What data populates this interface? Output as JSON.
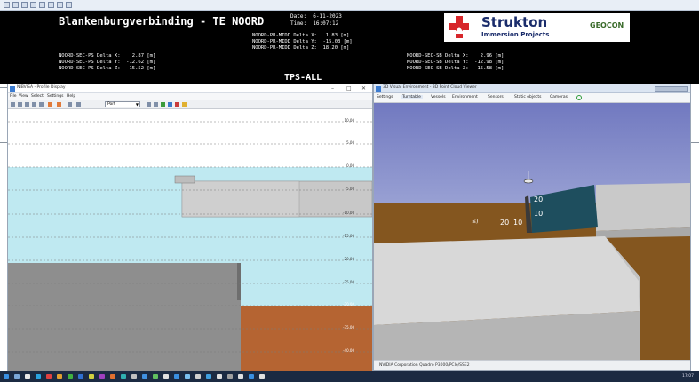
{
  "header": {
    "title": "Blankenburgverbinding - TE NOORD",
    "date_label": "Date:",
    "date_value": "6-11-2023",
    "time_label": "Time:",
    "time_value": "16:07:12",
    "midd_lines": [
      "NOORD-PR-MIDD Delta X:   1.83 [m]",
      "NOORD-PR-MIDD Delta Y:  -15.03 [m]",
      "NOORD-PR-MIDD Delta Z:  18.20 [m]"
    ],
    "ps_lines": [
      "NOORD-SEC-PS Delta X:    2.87 [m]",
      "NOORD-SEC-PS Delta Y:  -12.62 [m]",
      "NOORD-SEC-PS Delta Z:   15.52 [m]"
    ],
    "sb_lines": [
      "NOORD-SEC-SB Delta X:    2.96 [m]",
      "NOORD-SEC-SB Delta Y:  -12.98 [m]",
      "NOORD-SEC-SB Delta Z:   15.58 [m]"
    ],
    "tps": "TPS-ALL",
    "logo_name": "Strukton",
    "logo_sub": "Immersion Projects",
    "partner": "GEOCON"
  },
  "left_window": {
    "title": "NIBVISA - Profile Display",
    "menu": [
      "File",
      "View",
      "Select",
      "Settings",
      "Help"
    ],
    "port_select": "Port",
    "depth_labels": [
      "10.00",
      "5.00",
      "0.00",
      "-5.00",
      "-10.00",
      "-15.00",
      "-20.00",
      "-25.00",
      "-30.00",
      "-35.00",
      "-40.00"
    ]
  },
  "right_window": {
    "title": "3D Visual Environment - 3D Point Cloud Viewer",
    "tabs": [
      "Settings",
      "Turntable",
      "Vessels",
      "Environment",
      "Sensors",
      "Static objects",
      "Cameras"
    ],
    "labels": {
      "top": "20",
      "mid": "10",
      "dist_a": "20",
      "dist_b": "10"
    },
    "status": "NVIDIA Corporation Quadro P3000/PCIe/SSE2"
  },
  "taskbar": {
    "time": "17:07"
  },
  "colors": {
    "header_bg": "#000000",
    "water": "#bfe9f1",
    "seabed": "#b56432",
    "sky": "#7480c2",
    "element_green": "#1e4e5e"
  }
}
